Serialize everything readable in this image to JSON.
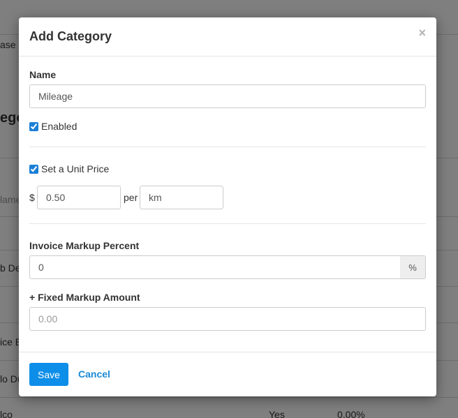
{
  "background": {
    "fragments": [
      "ase g",
      "ego",
      "lame",
      "b De",
      "ice B",
      "lo Du",
      "lco"
    ],
    "table_values": [
      "Yes",
      "0.00%"
    ]
  },
  "modal": {
    "title": "Add Category",
    "close_glyph": "×",
    "name": {
      "label": "Name",
      "value": "Mileage"
    },
    "enabled": {
      "label": "Enabled",
      "checked": true
    },
    "unit_price": {
      "label": "Set a Unit Price",
      "checked": true,
      "currency_symbol": "$",
      "price_value": "0.50",
      "per_text": "per",
      "unit_value": "km"
    },
    "markup_percent": {
      "label": "Invoice Markup Percent",
      "value": "0",
      "addon": "%"
    },
    "fixed_markup": {
      "label": "+ Fixed Markup Amount",
      "value": "",
      "placeholder": "0.00"
    },
    "footer": {
      "save_label": "Save",
      "cancel_label": "Cancel"
    }
  }
}
